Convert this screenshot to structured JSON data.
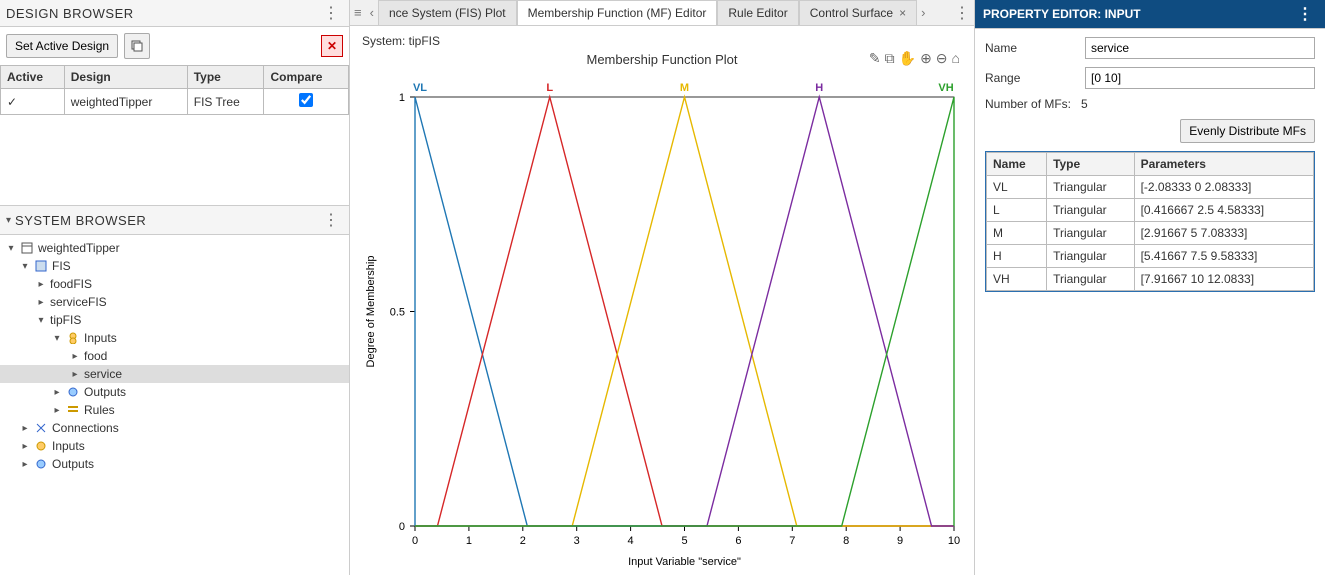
{
  "designBrowser": {
    "title": "DESIGN BROWSER",
    "setActiveBtn": "Set Active Design",
    "columns": {
      "active": "Active",
      "design": "Design",
      "type": "Type",
      "compare": "Compare"
    },
    "row": {
      "active": "✓",
      "design": "weightedTipper",
      "type": "FIS Tree"
    }
  },
  "systemBrowser": {
    "title": "SYSTEM BROWSER",
    "root": "weightedTipper",
    "fis": "FIS",
    "foodFIS": "foodFIS",
    "serviceFIS": "serviceFIS",
    "tipFIS": "tipFIS",
    "inputs": "Inputs",
    "food": "food",
    "service": "service",
    "outputs": "Outputs",
    "rules": "Rules",
    "connections": "Connections",
    "inputs2": "Inputs",
    "outputs2": "Outputs"
  },
  "tabs": {
    "t1": "nce System (FIS) Plot",
    "t2": "Membership Function (MF) Editor",
    "t3": "Rule Editor",
    "t4": "Control Surface"
  },
  "plot": {
    "system": "System: tipFIS",
    "title": "Membership Function Plot",
    "xlabel": "Input Variable \"service\"",
    "ylabel": "Degree of Membership",
    "labels": {
      "VL": "VL",
      "L": "L",
      "M": "M",
      "H": "H",
      "VH": "VH"
    }
  },
  "propEditor": {
    "title": "PROPERTY EDITOR: INPUT",
    "nameLabel": "Name",
    "nameValue": "service",
    "rangeLabel": "Range",
    "rangeValue": "[0 10]",
    "numMfLabel": "Number of MFs:",
    "numMfValue": "5",
    "distBtn": "Evenly Distribute MFs",
    "cols": {
      "name": "Name",
      "type": "Type",
      "params": "Parameters"
    },
    "rows": [
      {
        "n": "VL",
        "t": "Triangular",
        "p": "[-2.08333 0 2.08333]"
      },
      {
        "n": "L",
        "t": "Triangular",
        "p": "[0.416667 2.5 4.58333]"
      },
      {
        "n": "M",
        "t": "Triangular",
        "p": "[2.91667 5 7.08333]"
      },
      {
        "n": "H",
        "t": "Triangular",
        "p": "[5.41667 7.5 9.58333]"
      },
      {
        "n": "VH",
        "t": "Triangular",
        "p": "[7.91667 10 12.0833]"
      }
    ]
  },
  "chart_data": {
    "type": "line",
    "title": "Membership Function Plot",
    "xlabel": "Input Variable \"service\"",
    "ylabel": "Degree of Membership",
    "xlim": [
      0,
      10
    ],
    "ylim": [
      0,
      1
    ],
    "xticks": [
      0,
      1,
      2,
      3,
      4,
      5,
      6,
      7,
      8,
      9,
      10
    ],
    "yticks": [
      0,
      0.5,
      1
    ],
    "series": [
      {
        "name": "VL",
        "color": "#1f77b4",
        "x": [
          0,
          0,
          2.08333,
          10
        ],
        "y": [
          0,
          1,
          0,
          0
        ]
      },
      {
        "name": "L",
        "color": "#d62728",
        "x": [
          0,
          0.416667,
          2.5,
          4.58333,
          10
        ],
        "y": [
          0,
          0,
          1,
          0,
          0
        ]
      },
      {
        "name": "M",
        "color": "#e6b800",
        "x": [
          0,
          2.91667,
          5,
          7.08333,
          10
        ],
        "y": [
          0,
          0,
          1,
          0,
          0
        ]
      },
      {
        "name": "H",
        "color": "#7b2ca0",
        "x": [
          0,
          5.41667,
          7.5,
          9.58333,
          10
        ],
        "y": [
          0,
          0,
          1,
          0,
          0
        ]
      },
      {
        "name": "VH",
        "color": "#2ca02c",
        "x": [
          0,
          7.91667,
          10,
          10
        ],
        "y": [
          0,
          0,
          1,
          0
        ]
      }
    ]
  }
}
